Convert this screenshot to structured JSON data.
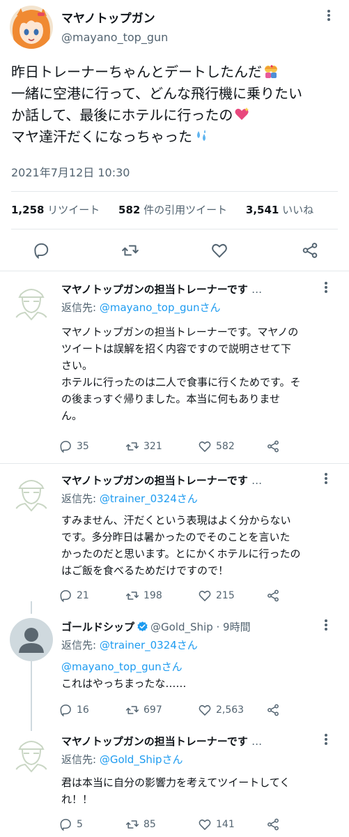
{
  "main_tweet": {
    "display_name": "マヤノトップガン",
    "handle": "@mayano_top_gun",
    "lines": [
      "昨日トレーナーちゃんとデートしたんだ",
      "一緒に空港に行って、どんな飛行機に乗りたい",
      "か話して、最後にホテルに行ったの",
      "マヤ達汗だくになっちゃった"
    ],
    "timestamp": "2021年7月12日 10:30",
    "retweets": "1,258",
    "retweets_label": "リツイート",
    "quotes": "582",
    "quotes_label": "件の引用ツイート",
    "likes": "3,541",
    "likes_label": "いいね"
  },
  "icons": {
    "main_actions": [
      "reply-icon",
      "retweet-icon",
      "like-icon",
      "share-icon"
    ],
    "emojis": [
      "couple-kiss-icon",
      "sparkling-heart-icon",
      "sweat-droplets-icon"
    ]
  },
  "colors": {
    "link": "#1d9bf0",
    "secondary_text": "#536471",
    "divider": "#e4e8eb"
  },
  "replies": [
    {
      "name": "マヤノトップガンの担当トレーナーです",
      "name_suffix": "…",
      "reply_prefix": "返信先: ",
      "reply_to": "@mayano_top_gunさん",
      "lines": [
        "マヤノトップガンの担当トレーナーです。マヤノの",
        "ツイートは誤解を招く内容ですので説明させて下",
        "さい。",
        "ホテルに行ったのは二人で食事に行くためです。そ",
        "の後まっすぐ帰りました。本当に何もありませ",
        "ん。"
      ],
      "replies": "35",
      "retweets": "321",
      "likes": "582"
    },
    {
      "name": "マヤノトップガンの担当トレーナーです",
      "name_suffix": "…",
      "reply_prefix": "返信先: ",
      "reply_to": "@trainer_0324さん",
      "lines": [
        "すみません、汗だくという表現はよく分からない",
        "です。多分昨日は暑かったのでそのことを言いた",
        "かったのだと思います。とにかくホテルに行ったの",
        "はご飯を食べるためだけですので！"
      ],
      "replies": "21",
      "retweets": "198",
      "likes": "215"
    },
    {
      "name": "ゴールドシップ",
      "handle_time": "@Gold_Ship · 9時間",
      "reply_prefix": "返信先: ",
      "reply_to": "@trainer_0324さん",
      "mention_line": "@mayano_top_gunさん",
      "lines": [
        "これはやっちまったな……"
      ],
      "replies": "16",
      "retweets": "697",
      "likes": "2,563"
    },
    {
      "name": "マヤノトップガンの担当トレーナーです",
      "name_suffix": "…",
      "reply_prefix": "返信先: ",
      "reply_to": "@Gold_Shipさん",
      "lines": [
        "君は本当に自分の影響力を考えてツイートしてく",
        "れ！！"
      ],
      "replies": "5",
      "retweets": "85",
      "likes": "141"
    }
  ]
}
